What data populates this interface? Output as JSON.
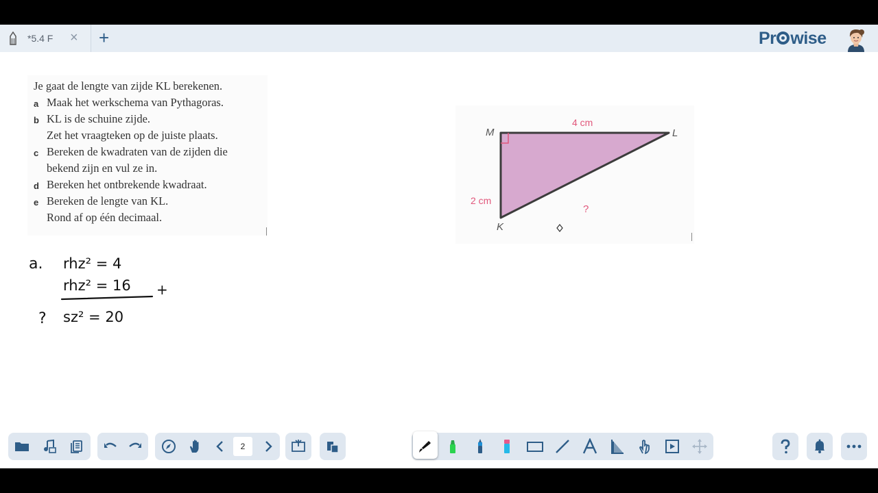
{
  "tab": {
    "title": "*5.4 F",
    "close_icon": "×",
    "add_icon": "+"
  },
  "brand": {
    "pre": "Pr",
    "post": "wise",
    "color": "#2e5d88"
  },
  "worksheet": {
    "intro": "Je gaat de lengte van zijde KL berekenen.",
    "items": [
      {
        "label": "a",
        "lines": [
          "Maak het werkschema van Pythagoras."
        ]
      },
      {
        "label": "b",
        "lines": [
          "KL is de schuine zijde.",
          "Zet het vraagteken op de juiste plaats."
        ]
      },
      {
        "label": "c",
        "lines": [
          "Bereken de kwadraten van de zijden die",
          "bekend zijn en vul ze in."
        ]
      },
      {
        "label": "d",
        "lines": [
          "Bereken het ontbrekende kwadraat."
        ]
      },
      {
        "label": "e",
        "lines": [
          "Bereken de lengte van KL.",
          "Rond af op één decimaal."
        ]
      }
    ]
  },
  "figure": {
    "vertex_m": "M",
    "vertex_l": "L",
    "vertex_k": "K",
    "side_ml": "4 cm",
    "side_mk": "2 cm",
    "side_kl": "?",
    "fill_color": "#d7a9cf",
    "label_color": "#e1577b"
  },
  "handwriting": {
    "label": "a.",
    "row1": "rhz² = 4",
    "row2": "rhz² = 16",
    "plus": "+",
    "question": "?",
    "row3": "sz² = 20"
  },
  "toolbar": {
    "page_number": "2",
    "left_tools": [
      "folder-icon",
      "media-icon",
      "copy-pages-icon",
      "undo-icon",
      "redo-icon",
      "compass-icon",
      "hand-pan-icon",
      "prev-page-icon",
      "next-page-icon",
      "screen-capture-icon",
      "paste-icon"
    ],
    "draw_tools": [
      "pen-icon",
      "highlighter-icon",
      "marker-icon",
      "eraser-icon",
      "rectangle-icon",
      "line-icon",
      "text-icon",
      "ruler-icon",
      "pointer-hand-icon",
      "insert-box-icon",
      "move-icon"
    ],
    "right_tools": [
      "help-icon",
      "notification-bell-icon",
      "more-icon"
    ],
    "accent": "#2e5d88"
  }
}
